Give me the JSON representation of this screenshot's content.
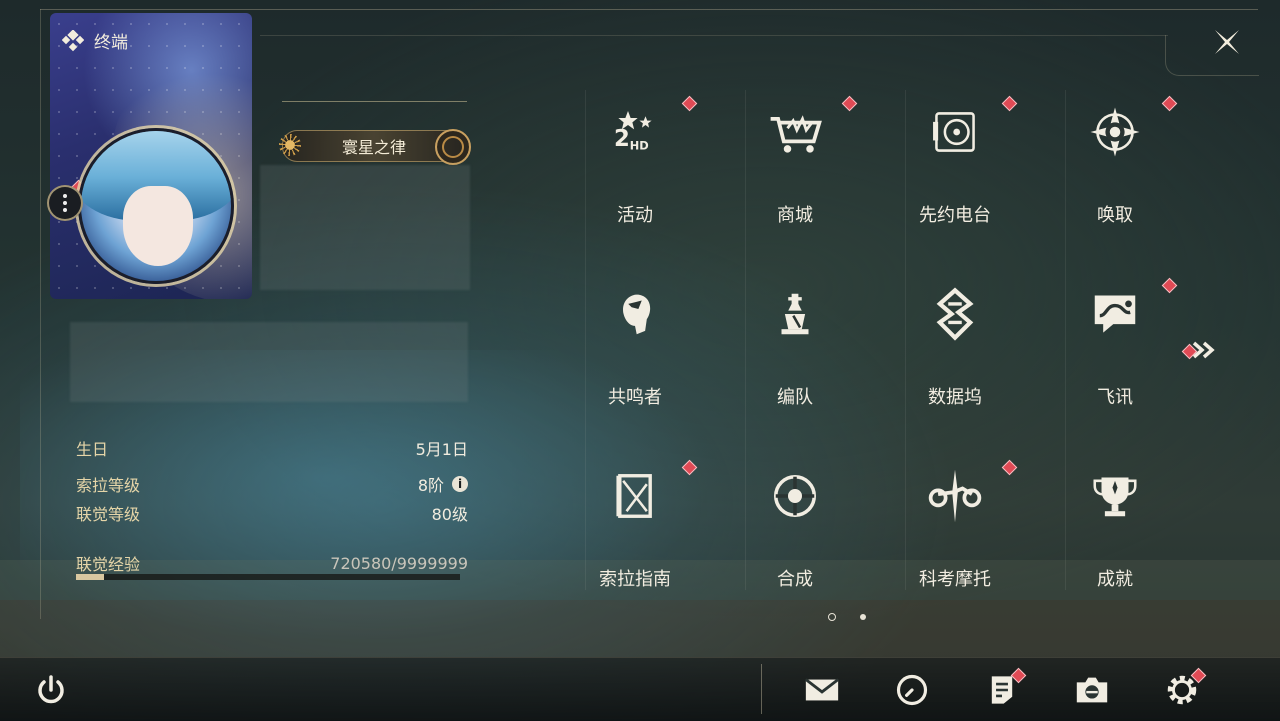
{
  "header": {
    "title": "终端",
    "title_icon": "grid-diamond-icon",
    "close_icon": "close-x-icon"
  },
  "profile": {
    "title_badge": "寰星之律",
    "more_icon": "more-vertical-icon"
  },
  "stats": {
    "birthday_label": "生日",
    "birthday_value": "5月1日",
    "sola_level_label": "索拉等级",
    "sola_level_value": "8阶",
    "union_level_label": "联觉等级",
    "union_level_value": "80级",
    "union_exp_label": "联觉经验",
    "union_exp_value": "720580/9999999",
    "union_exp_fraction": 0.072
  },
  "menu": {
    "items": [
      {
        "label": "活动",
        "icon": "events-2hd-icon",
        "badge": true
      },
      {
        "label": "商城",
        "icon": "shop-cart-icon",
        "badge": true
      },
      {
        "label": "先约电台",
        "icon": "radio-record-icon",
        "badge": true
      },
      {
        "label": "唤取",
        "icon": "convene-compass-icon",
        "badge": true
      },
      {
        "label": "共鸣者",
        "icon": "resonator-head-icon",
        "badge": false
      },
      {
        "label": "编队",
        "icon": "team-chess-icon",
        "badge": false
      },
      {
        "label": "数据坞",
        "icon": "data-bank-icon",
        "badge": false
      },
      {
        "label": "飞讯",
        "icon": "message-bubble-icon",
        "badge": true
      },
      {
        "label": "索拉指南",
        "icon": "guide-book-icon",
        "badge": true
      },
      {
        "label": "合成",
        "icon": "synthesis-ring-icon",
        "badge": false
      },
      {
        "label": "科考摩托",
        "icon": "motorcycle-icon",
        "badge": true
      },
      {
        "label": "成就",
        "icon": "trophy-icon",
        "badge": false
      }
    ],
    "next_page_icon": "double-chevron-right-icon",
    "page_count": 2,
    "current_page": 1
  },
  "bottom_bar": {
    "icons": [
      "power-icon",
      "mail-icon",
      "clock-icon",
      "notes-icon",
      "camera-icon",
      "settings-gear-icon"
    ]
  },
  "colors": {
    "badge_red": "#e04a55",
    "label_gold": "#e5d5a8",
    "text_light": "#f2ede1"
  }
}
